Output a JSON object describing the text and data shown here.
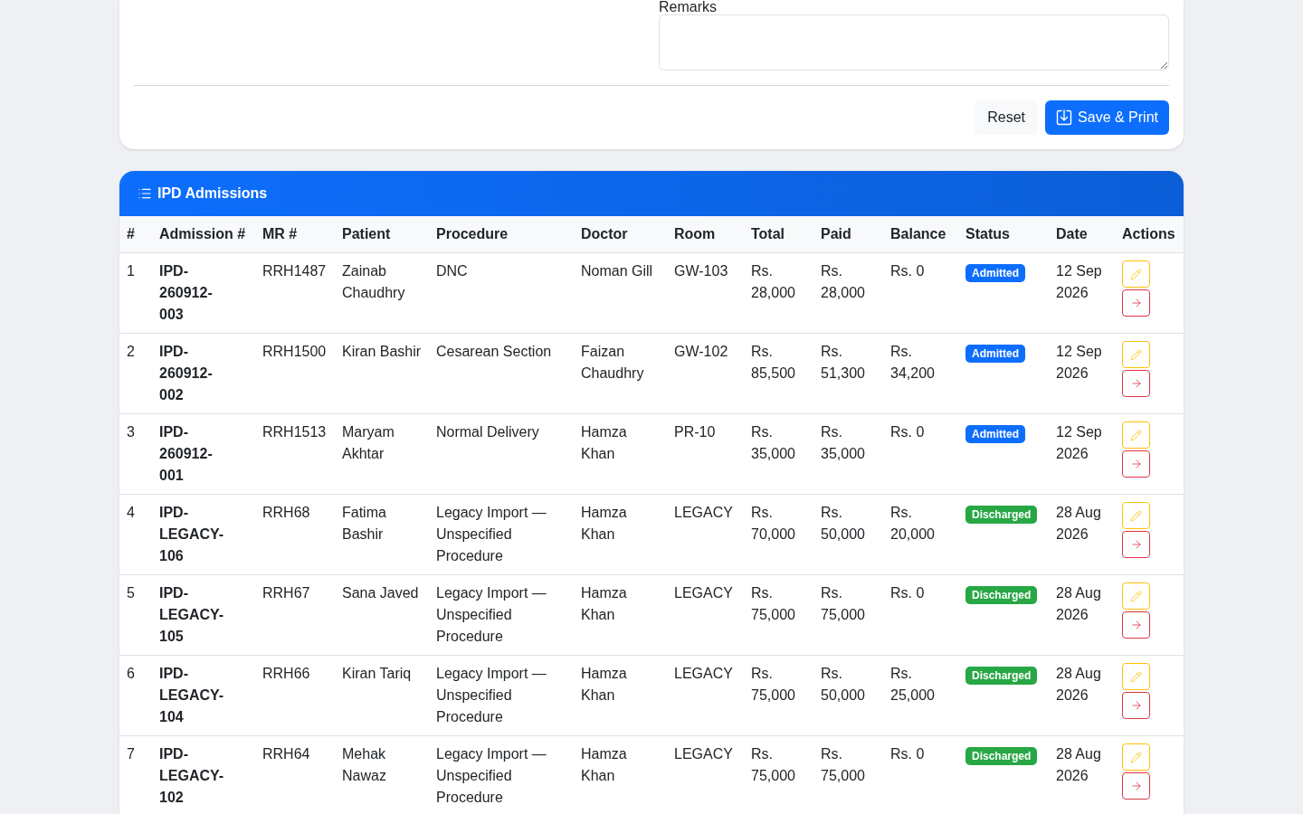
{
  "form": {
    "remarks_field": {
      "label": "Remarks"
    },
    "buttons": [
      {
        "kind": "secondary",
        "label": "Reset"
      },
      {
        "kind": "primary",
        "label": "Save & Print"
      }
    ]
  },
  "admissions": {
    "title": "IPD Admissions",
    "columns": [
      "#",
      "Admission #",
      "MR #",
      "Patient",
      "Procedure",
      "Doctor",
      "Room",
      "Total",
      "Paid",
      "Balance",
      "Status",
      "Date",
      "Actions"
    ],
    "rows": [
      {
        "index": "1",
        "admission_no": "IPD-260912-003",
        "mr_no": "RRH1487",
        "patient": "Zainab Chaudhry",
        "procedure": "DNC",
        "doctor": "Noman Gill",
        "room": "GW-103",
        "total": "Rs. 28,000",
        "paid": "Rs. 28,000",
        "balance": "Rs. 0",
        "status": {
          "label": "Admitted",
          "color": "#0d6efd"
        },
        "date": "12 Sep 2026"
      },
      {
        "index": "2",
        "admission_no": "IPD-260912-002",
        "mr_no": "RRH1500",
        "patient": "Kiran Bashir",
        "procedure": "Cesarean Section",
        "doctor": "Faizan Chaudhry",
        "room": "GW-102",
        "total": "Rs. 85,500",
        "paid": "Rs. 51,300",
        "balance": "Rs. 34,200",
        "status": {
          "label": "Admitted",
          "color": "#0d6efd"
        },
        "date": "12 Sep 2026"
      },
      {
        "index": "3",
        "admission_no": "IPD-260912-001",
        "mr_no": "RRH1513",
        "patient": "Maryam Akhtar",
        "procedure": "Normal Delivery",
        "doctor": "Hamza Khan",
        "room": "PR-10",
        "total": "Rs. 35,000",
        "paid": "Rs. 35,000",
        "balance": "Rs. 0",
        "status": {
          "label": "Admitted",
          "color": "#0d6efd"
        },
        "date": "12 Sep 2026"
      },
      {
        "index": "4",
        "admission_no": "IPD-LEGACY-106",
        "mr_no": "RRH68",
        "patient": "Fatima Bashir",
        "procedure": "Legacy Import — Unspecified Procedure",
        "doctor": "Hamza Khan",
        "room": "LEGACY",
        "total": "Rs. 70,000",
        "paid": "Rs. 50,000",
        "balance": "Rs. 20,000",
        "status": {
          "label": "Discharged",
          "color": "#28a745"
        },
        "date": "28 Aug 2026"
      },
      {
        "index": "5",
        "admission_no": "IPD-LEGACY-105",
        "mr_no": "RRH67",
        "patient": "Sana Javed",
        "procedure": "Legacy Import — Unspecified Procedure",
        "doctor": "Hamza Khan",
        "room": "LEGACY",
        "total": "Rs. 75,000",
        "paid": "Rs. 75,000",
        "balance": "Rs. 0",
        "status": {
          "label": "Discharged",
          "color": "#28a745"
        },
        "date": "28 Aug 2026"
      },
      {
        "index": "6",
        "admission_no": "IPD-LEGACY-104",
        "mr_no": "RRH66",
        "patient": "Kiran Tariq",
        "procedure": "Legacy Import — Unspecified Procedure",
        "doctor": "Hamza Khan",
        "room": "LEGACY",
        "total": "Rs. 75,000",
        "paid": "Rs. 50,000",
        "balance": "Rs. 25,000",
        "status": {
          "label": "Discharged",
          "color": "#28a745"
        },
        "date": "28 Aug 2026"
      },
      {
        "index": "7",
        "admission_no": "IPD-LEGACY-102",
        "mr_no": "RRH64",
        "patient": "Mehak Nawaz",
        "procedure": "Legacy Import — Unspecified Procedure",
        "doctor": "Hamza Khan",
        "room": "LEGACY",
        "total": "Rs. 75,000",
        "paid": "Rs. 75,000",
        "balance": "Rs. 0",
        "status": {
          "label": "Discharged",
          "color": "#28a745"
        },
        "date": "28 Aug 2026"
      }
    ]
  }
}
